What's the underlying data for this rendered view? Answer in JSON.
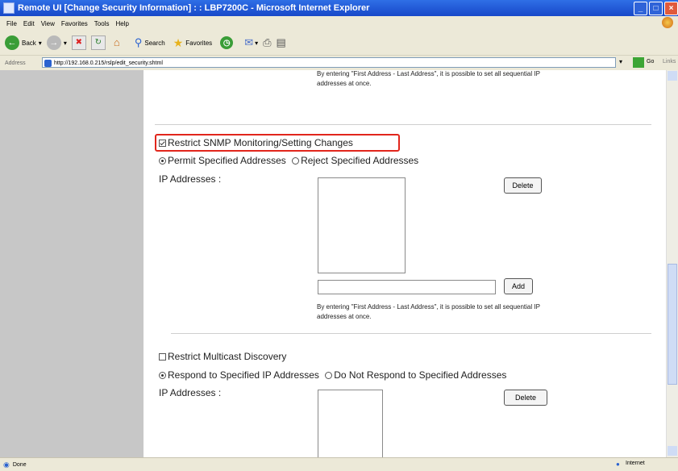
{
  "window": {
    "title": "Remote UI [Change Security Information] : : LBP7200C - Microsoft Internet Explorer",
    "controls": [
      "_",
      "□",
      "×"
    ]
  },
  "menu": [
    "File",
    "Edit",
    "View",
    "Favorites",
    "Tools",
    "Help"
  ],
  "toolbar": {
    "back_label": "Back",
    "search_label": "Search",
    "favorites_label": "Favorites"
  },
  "address": {
    "label": "Address",
    "url": "http://192.168.0.215/rslp/edit_security.shtml",
    "go_label": "Go",
    "links_label": "Links"
  },
  "content": {
    "top_note_line1": "By entering \"First Address - Last Address\", it is possible to set all sequential IP",
    "top_note_line2": "addresses at once.",
    "snmp": {
      "checkbox_label": "Restrict SNMP Monitoring/Setting Changes",
      "checked": true,
      "radio_permit": "Permit Specified Addresses",
      "radio_reject": "Reject Specified Addresses",
      "selected": "permit",
      "ip_label": "IP Addresses :",
      "delete_label": "Delete",
      "add_label": "Add",
      "note_line1": "By entering \"First Address - Last Address\", it is possible to set all sequential IP",
      "note_line2": "addresses at once."
    },
    "multicast": {
      "checkbox_label": "Restrict Multicast Discovery",
      "checked": false,
      "radio_respond": "Respond to Specified IP Addresses",
      "radio_not_respond": "Do Not Respond to Specified Addresses",
      "selected": "respond",
      "ip_label": "IP Addresses :",
      "delete_label": "Delete"
    }
  },
  "status": {
    "left": "Done",
    "zone": "Internet"
  },
  "colors": {
    "highlight": "#e1261c",
    "title_bar": "#1f56d6",
    "left_pane": "#c7c7c7"
  }
}
